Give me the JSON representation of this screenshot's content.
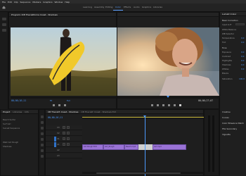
{
  "menubar": [
    "File",
    "Edit",
    "Clip",
    "Sequence",
    "Markers",
    "Graphics",
    "Window",
    "Help"
  ],
  "workspaces": {
    "items": [
      "Learning",
      "Assembly",
      "Editing",
      "Color",
      "Effects",
      "Audio",
      "Graphics",
      "Libraries"
    ],
    "active": "Color"
  },
  "source_monitor": {
    "tabs": [
      "Program: ICB Thecalifornia Coast - Shadows",
      "≡"
    ],
    "timecode": "00;00;16;11",
    "zoom": "Fit",
    "fraction": "Full",
    "end_timecode": "00;00;28;08"
  },
  "program_monitor": {
    "timecode": "00;00;16;11",
    "end_timecode": "00;00;27;07"
  },
  "essential_graphics": {
    "title": "Lumetri Color",
    "sections": [
      "Basic Correction",
      "Input LUT",
      "White Balance",
      "WB Selector",
      "Temperature",
      "Tint",
      "Tone",
      "Exposure",
      "Contrast",
      "Highlights",
      "Shadows",
      "Whites",
      "Blacks",
      "Saturation",
      "Creative",
      "Curves",
      "Color Wheels & Match",
      "HSL Secondary",
      "Vignette"
    ],
    "values": [
      "0.0",
      "0.0",
      "0.0",
      "0.0",
      "0.0",
      "0.0",
      "0.0",
      "100.0"
    ]
  },
  "project_panel": {
    "tabs": [
      "Project",
      "Libraries",
      "Info"
    ],
    "items": [
      "Beach Surfer",
      "Surf Girl",
      "Sunset Sequence",
      "Walk Girl Rough",
      "Shadows"
    ]
  },
  "timeline": {
    "tabs": [
      "CB Thecalif. Coast - Shadows",
      "CB Thecalif. Coast - Shadows Ext"
    ],
    "timecode": "00;00;16;11",
    "tracks": [
      "V3",
      "V2",
      "V1",
      "A1",
      "A2",
      "A3"
    ],
    "clips": [
      "Girl Rough Edit",
      "Girl_Rough",
      "Beach.mp4",
      "Girl.mp4",
      "Sunset.mp4"
    ]
  },
  "colors": {
    "accent": "#4d9bff",
    "clip": "#9a73d6",
    "panel": "#1e1e1e"
  }
}
